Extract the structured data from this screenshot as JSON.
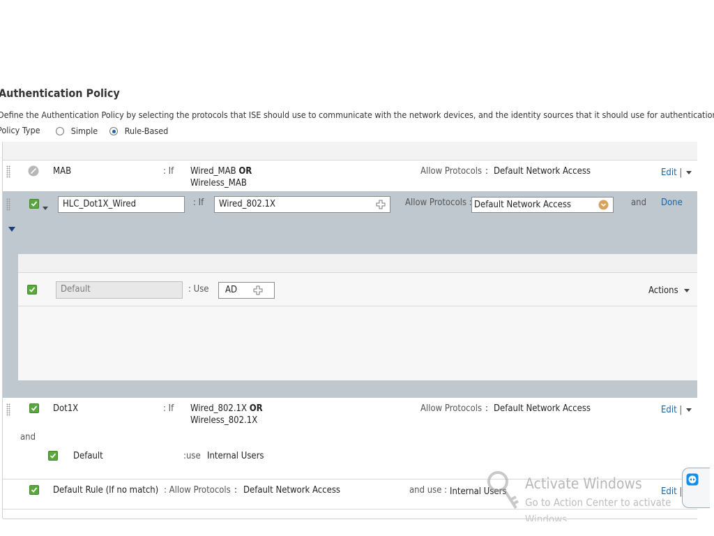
{
  "page": {
    "title": "Authentication Policy",
    "description": "Define the Authentication Policy by selecting the protocols that ISE should use to communicate with the network devices, and the identity sources that it should use for authentication.",
    "policy_type_label": "Policy Type",
    "policy_type_options": [
      "Simple",
      "Rule-Based"
    ],
    "policy_type_selected": "Rule-Based"
  },
  "rules": {
    "mab": {
      "name": "MAB",
      "if_label": ": If",
      "condition_line1": "Wired_MAB",
      "condition_op": "OR",
      "condition_line2": "Wireless_MAB",
      "allow_label": "Allow Protocols",
      "allow_sep": ":",
      "allow_value": "Default Network Access",
      "edit": "Edit",
      "edit_sep": "|"
    },
    "editing": {
      "name_value": "HLC_Dot1X_Wired",
      "if_label": ": If",
      "condition_value": "Wired_802.1X",
      "allow_label": "Allow Protocols :",
      "allow_value": "Default Network Access",
      "and_label": "and",
      "done": "Done",
      "default_sub": {
        "name_value": "Default",
        "use_label": ":   Use",
        "identity_value": "AD",
        "actions": "Actions"
      }
    },
    "dot1x": {
      "name": "Dot1X",
      "if_label": ": If",
      "condition_line1": "Wired_802.1X",
      "condition_op": "OR",
      "condition_line2": "Wireless_802.1X",
      "allow_label": "Allow Protocols",
      "allow_sep": ":",
      "allow_value": "Default Network Access",
      "edit": "Edit",
      "edit_sep": "|",
      "and_label": "and",
      "sub_name": "Default",
      "sub_use_label": ":use",
      "sub_use_value": "Internal Users"
    },
    "default_rule": {
      "name": "Default Rule (If no match)",
      "allow_label": ": Allow Protocols",
      "allow_sep": ":",
      "allow_value": "Default Network Access",
      "and_use_label": "and use :",
      "and_use_value": "Internal Users",
      "edit": "Edit",
      "edit_sep": "|"
    }
  },
  "watermark": {
    "line1": "Activate Windows",
    "line2": "Go to Action Center to activate",
    "line3": "Windows."
  },
  "colors": {
    "accent": "#1565a8",
    "editing_panel": "#bfc7cf",
    "check_green": "#5aa83c",
    "orange_dropdown": "#d7a25a"
  }
}
